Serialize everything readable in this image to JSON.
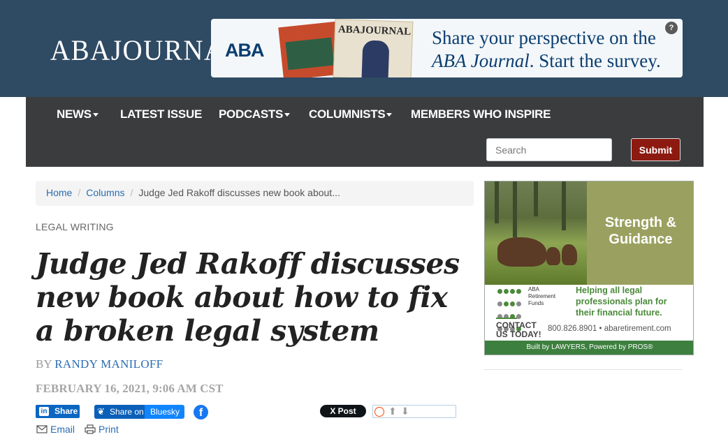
{
  "header": {
    "logo_text": "ABAJOURNAL",
    "banner": {
      "brand": "ABA",
      "mag_title": "ABAJOURNAL",
      "line1": "Share your perspective on the",
      "line2_a": "ABA Journal",
      "line2_b": ". Start the survey.",
      "help": "?"
    }
  },
  "nav": {
    "items": [
      {
        "label": "NEWS",
        "dropdown": true
      },
      {
        "label": "LATEST ISSUE",
        "dropdown": false
      },
      {
        "label": "PODCASTS",
        "dropdown": true
      },
      {
        "label": "COLUMNISTS",
        "dropdown": true
      },
      {
        "label": "MEMBERS WHO INSPIRE",
        "dropdown": false
      }
    ],
    "search_placeholder": "Search",
    "submit_label": "Submit"
  },
  "breadcrumb": {
    "home": "Home",
    "columns": "Columns",
    "current": "Judge Jed Rakoff discusses new book about..."
  },
  "article": {
    "category": "LEGAL WRITING",
    "title": "Judge Jed Rakoff discusses new book about how to fix a broken legal system",
    "by_prefix": "BY",
    "author": "RANDY MANILOFF",
    "date": "FEBRUARY 16, 2021, 9:06 AM CST"
  },
  "share": {
    "linkedin_label": "Share",
    "linkedin_icon_text": "in",
    "bluesky_left": "Share on",
    "bluesky_right": "Bluesky",
    "facebook_icon_text": "f",
    "x_label": "X Post",
    "email_label": "Email",
    "print_label": "Print"
  },
  "ad": {
    "headline1": "Strength &",
    "headline2": "Guidance",
    "fund_name": "ABA Retirement Funds",
    "tagline": "Helping all legal professionals plan for their financial future.",
    "contact": "CONTACT US TODAY!",
    "phone": "800.826.8901 • abaretirement.com",
    "footer": "Built by LAWYERS, Powered by PROS®",
    "colors": {
      "green": "#4a8a3a",
      "olive": "#9aa160",
      "footer": "#3d7f3e"
    }
  },
  "colors": {
    "header_bg": "#2f4a63",
    "nav_bg": "#3a3c3e",
    "submit_bg": "#8c1a10",
    "link": "#2a6db0"
  }
}
